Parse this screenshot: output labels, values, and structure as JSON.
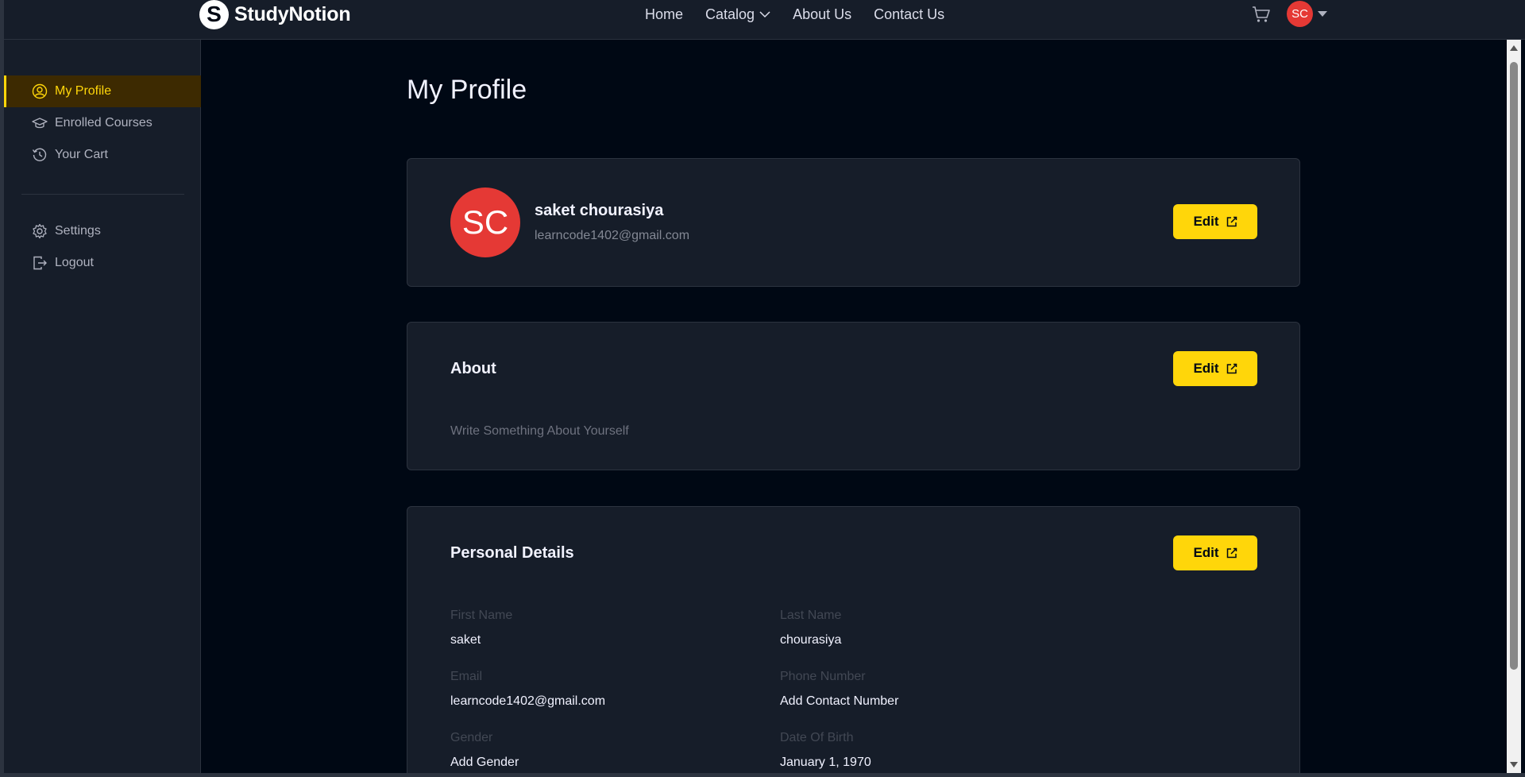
{
  "brand": {
    "logo_letter": "S",
    "name": "StudyNotion"
  },
  "nav": {
    "links": [
      "Home",
      "Catalog",
      "About Us",
      "Contact Us"
    ],
    "avatar_initials": "SC"
  },
  "sidebar": {
    "items": [
      {
        "label": "My Profile",
        "icon": "user-circle-icon",
        "active": true
      },
      {
        "label": "Enrolled Courses",
        "icon": "graduation-cap-icon"
      },
      {
        "label": "Your Cart",
        "icon": "history-icon"
      }
    ],
    "bottom_items": [
      {
        "label": "Settings",
        "icon": "gear-icon"
      },
      {
        "label": "Logout",
        "icon": "logout-icon"
      }
    ]
  },
  "page": {
    "title": "My Profile"
  },
  "profile_card": {
    "avatar_initials": "SC",
    "name": "saket chourasiya",
    "email": "learncode1402@gmail.com",
    "edit_label": "Edit"
  },
  "about_card": {
    "heading": "About",
    "text": "Write Something About Yourself",
    "edit_label": "Edit"
  },
  "personal_card": {
    "heading": "Personal Details",
    "edit_label": "Edit",
    "fields": [
      {
        "label": "First Name",
        "value": "saket"
      },
      {
        "label": "Last Name",
        "value": "chourasiya"
      },
      {
        "label": "Email",
        "value": "learncode1402@gmail.com"
      },
      {
        "label": "Phone Number",
        "value": "Add Contact Number"
      },
      {
        "label": "Gender",
        "value": "Add Gender"
      },
      {
        "label": "Date Of Birth",
        "value": "January 1, 1970"
      }
    ]
  },
  "colors": {
    "accent": "#FFD60A",
    "page_bg": "#000814",
    "panel_bg": "#161D29",
    "avatar_bg": "#E53935"
  }
}
